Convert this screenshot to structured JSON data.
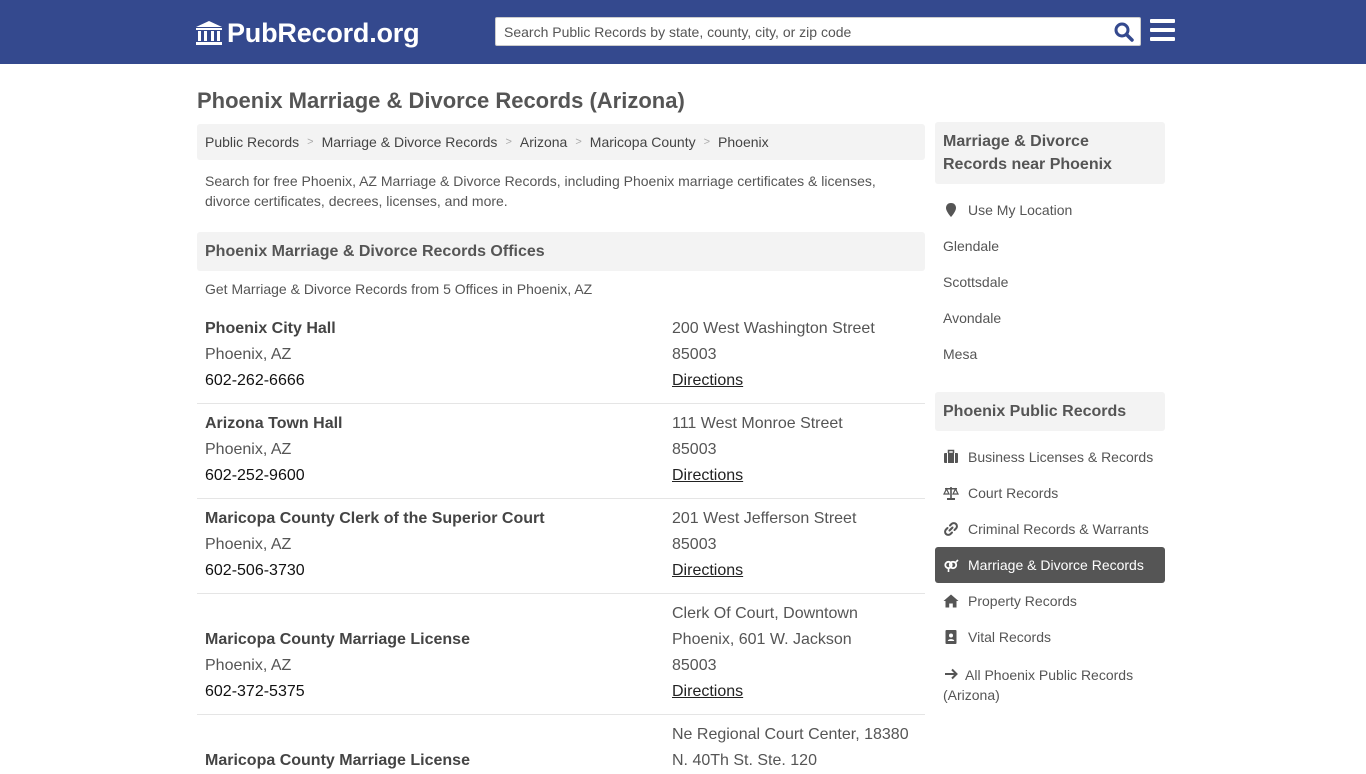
{
  "header": {
    "logo_text": "PubRecord.org",
    "search_placeholder": "Search Public Records by state, county, city, or zip code"
  },
  "page": {
    "title": "Phoenix Marriage & Divorce Records (Arizona)",
    "intro": "Search for free Phoenix, AZ Marriage & Divorce Records, including Phoenix marriage certificates & licenses, divorce certificates, decrees, licenses, and more."
  },
  "breadcrumb": [
    "Public Records",
    "Marriage & Divorce Records",
    "Arizona",
    "Maricopa County",
    "Phoenix"
  ],
  "offices_section": {
    "title": "Phoenix Marriage & Divorce Records Offices",
    "subtitle": "Get Marriage & Divorce Records from 5 Offices in Phoenix, AZ"
  },
  "offices": [
    {
      "name": "Phoenix City Hall",
      "city": "Phoenix, AZ",
      "phone": "602-262-6666",
      "address": [
        "200 West Washington Street",
        "85003"
      ],
      "directions": "Directions"
    },
    {
      "name": "Arizona Town Hall",
      "city": "Phoenix, AZ",
      "phone": "602-252-9600",
      "address": [
        "111 West Monroe Street",
        "85003"
      ],
      "directions": "Directions"
    },
    {
      "name": "Maricopa County Clerk of the Superior Court",
      "city": "Phoenix, AZ",
      "phone": "602-506-3730",
      "address": [
        "201 West Jefferson Street",
        "85003"
      ],
      "directions": "Directions"
    },
    {
      "name": "Maricopa County Marriage License",
      "city": "Phoenix, AZ",
      "phone": "602-372-5375",
      "address": [
        "Clerk Of Court, Downtown",
        "Phoenix, 601 W. Jackson",
        "85003"
      ],
      "directions": "Directions"
    },
    {
      "name": "Maricopa County Marriage License",
      "address": [
        "Ne Regional Court Center, 18380",
        "N. 40Th St. Ste. 120"
      ]
    }
  ],
  "sidebar": {
    "nearby_title": "Marriage & Divorce Records near Phoenix",
    "use_location": "Use My Location",
    "nearby": [
      "Glendale",
      "Scottsdale",
      "Avondale",
      "Mesa"
    ],
    "public_title": "Phoenix Public Records",
    "public_links": [
      {
        "label": "Business Licenses & Records",
        "icon": "briefcase-icon"
      },
      {
        "label": "Court Records",
        "icon": "scale-icon"
      },
      {
        "label": "Criminal Records & Warrants",
        "icon": "link-icon"
      },
      {
        "label": "Marriage & Divorce Records",
        "icon": "gender-icon",
        "active": true
      },
      {
        "label": "Property Records",
        "icon": "home-icon"
      },
      {
        "label": "Vital Records",
        "icon": "contact-book-icon"
      }
    ],
    "all_records": "All Phoenix Public Records (Arizona)"
  },
  "colors": {
    "header_bg": "#34498e",
    "panel_bg": "#f3f3f3",
    "active_bg": "#555555",
    "search_icon": "#34498e"
  }
}
